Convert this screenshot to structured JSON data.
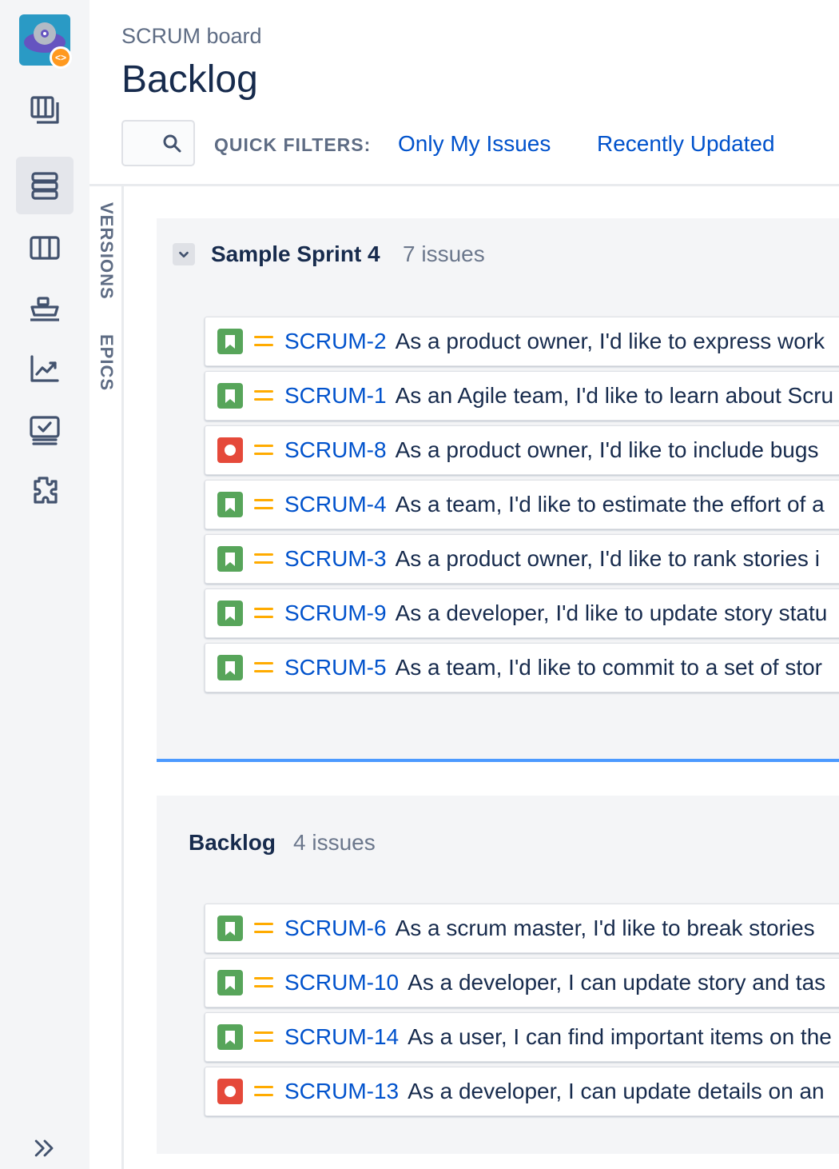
{
  "header": {
    "project_name": "SCRUM board",
    "page_title": "Backlog",
    "search_placeholder": "",
    "quick_filters_label": "QUICK FILTERS:",
    "quick_filters": [
      "Only My Issues",
      "Recently Updated"
    ]
  },
  "side_tabs": [
    "VERSIONS",
    "EPICS"
  ],
  "sidebar": {
    "items": [
      "roadmap-icon",
      "backlog-icon",
      "board-icon",
      "releases-icon",
      "reports-icon",
      "issues-icon",
      "addons-icon"
    ],
    "active": "backlog-icon",
    "logo_badge": "<>"
  },
  "sprint": {
    "title": "Sample Sprint 4",
    "count": "7 issues",
    "issues": [
      {
        "type": "story",
        "key": "SCRUM-2",
        "summary": "As a product owner, I'd like to express work"
      },
      {
        "type": "story",
        "key": "SCRUM-1",
        "summary": "As an Agile team, I'd like to learn about Scru"
      },
      {
        "type": "bug",
        "key": "SCRUM-8",
        "summary": "As a product owner, I'd like to include bugs"
      },
      {
        "type": "story",
        "key": "SCRUM-4",
        "summary": "As a team, I'd like to estimate the effort of a"
      },
      {
        "type": "story",
        "key": "SCRUM-3",
        "summary": "As a product owner, I'd like to rank stories i"
      },
      {
        "type": "story",
        "key": "SCRUM-9",
        "summary": "As a developer, I'd like to update story statu"
      },
      {
        "type": "story",
        "key": "SCRUM-5",
        "summary": "As a team, I'd like to commit to a set of stor"
      }
    ]
  },
  "backlog": {
    "title": "Backlog",
    "count": "4 issues",
    "issues": [
      {
        "type": "story",
        "key": "SCRUM-6",
        "summary": "As a scrum master, I'd like to break stories"
      },
      {
        "type": "story",
        "key": "SCRUM-10",
        "summary": "As a developer, I can update story and tas"
      },
      {
        "type": "story",
        "key": "SCRUM-14",
        "summary": "As a user, I can find important items on the"
      },
      {
        "type": "bug",
        "key": "SCRUM-13",
        "summary": "As a developer, I can update details on an"
      }
    ]
  },
  "colors": {
    "link": "#0052cc",
    "story": "#57a55a",
    "bug": "#e5493a",
    "priority_medium": "#ffab00",
    "sprint_underline": "#4c9aff"
  }
}
